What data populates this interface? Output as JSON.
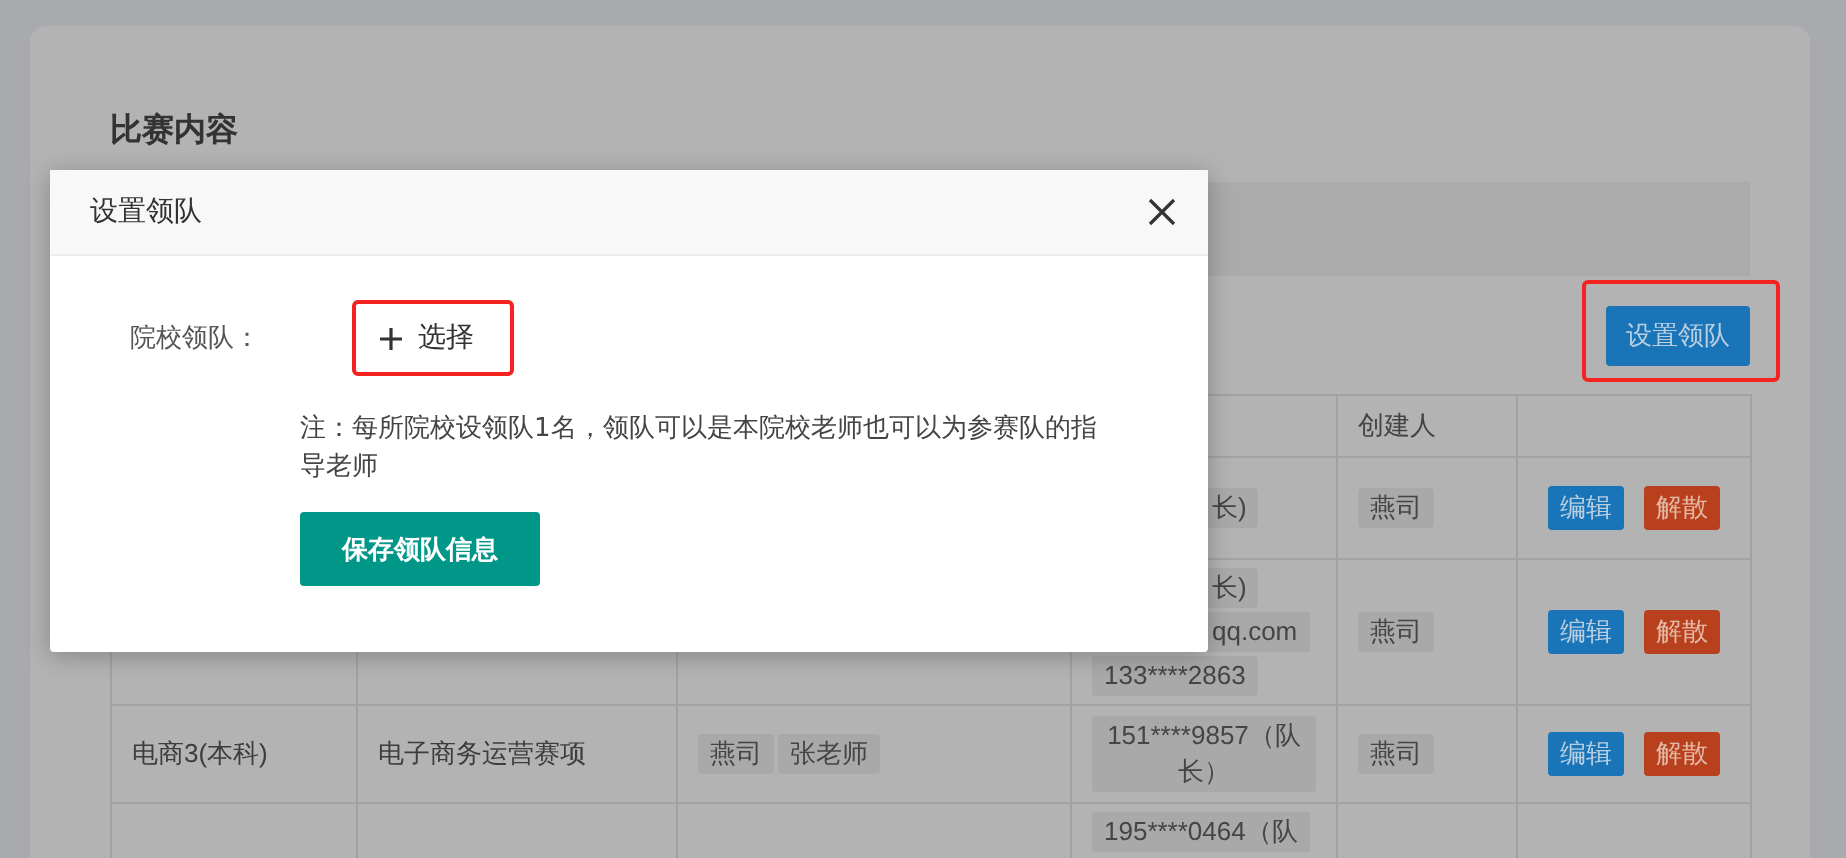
{
  "page": {
    "title": "比赛内容",
    "set_leader_button": {
      "label": "设置领队",
      "highlighted": true
    },
    "table": {
      "header": {
        "column_5": "创建人"
      },
      "rows": [
        {
          "column_4": {
            "kind": "tags",
            "tags": [
              {
                "text": "长)"
              }
            ]
          },
          "column_5": {
            "kind": "tags",
            "tags": [
              {
                "text": "燕司"
              }
            ]
          },
          "column_6": {
            "kind": "actions",
            "buttons": [
              {
                "label": "编辑",
                "kind": "edit"
              },
              {
                "label": "解散",
                "kind": "disband"
              }
            ]
          }
        },
        {
          "column_4": {
            "kind": "tags",
            "tags": [
              {
                "text": "长)"
              },
              {
                "text": "qq.com"
              },
              {
                "text": "133****2863"
              }
            ]
          },
          "column_5": {
            "kind": "tags",
            "tags": [
              {
                "text": "燕司"
              }
            ]
          },
          "column_6": {
            "kind": "actions",
            "buttons": [
              {
                "label": "编辑",
                "kind": "edit"
              },
              {
                "label": "解散",
                "kind": "disband"
              }
            ]
          }
        },
        {
          "column_1": {
            "kind": "text",
            "text": "电商3(本科)"
          },
          "column_2": {
            "kind": "text",
            "text": "电子商务运营赛项"
          },
          "column_3": {
            "kind": "tags",
            "tags": [
              {
                "text": "燕司"
              },
              {
                "text": "张老师"
              }
            ]
          },
          "column_4": {
            "kind": "tags",
            "tags": [
              {
                "text": "151****9857（队长）"
              }
            ]
          },
          "column_5": {
            "kind": "tags",
            "tags": [
              {
                "text": "燕司"
              }
            ]
          },
          "column_6": {
            "kind": "actions",
            "buttons": [
              {
                "label": "编辑",
                "kind": "edit"
              },
              {
                "label": "解散",
                "kind": "disband"
              }
            ]
          }
        },
        {
          "column_4": {
            "kind": "tags",
            "tags": [
              {
                "text": "195****0464（队"
              }
            ]
          }
        }
      ]
    }
  },
  "dialog": {
    "title": "设置领队",
    "field_label": "院校领队：",
    "select_button": {
      "label": "选择",
      "highlighted": true
    },
    "note": "注：每所院校设领队1名，领队可以是本院校老师也可以为参赛队的指导老师",
    "save_button": "保存领队信息"
  }
}
